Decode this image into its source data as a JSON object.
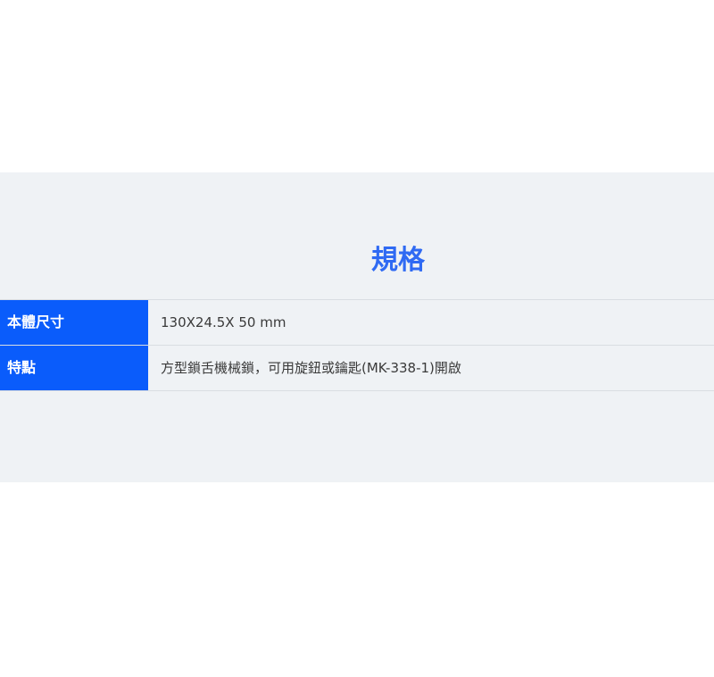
{
  "spec": {
    "title": "規格",
    "rows": [
      {
        "label": "本體尺寸",
        "value": "130X24.5X 50 mm"
      },
      {
        "label": "特點",
        "value": "方型鎖舌機械鎖，可用旋鈕或鑰匙(MK-338-1)開啟"
      }
    ]
  },
  "colors": {
    "section_background": "#eff2f5",
    "title": "#2f6af3",
    "label_background": "#0a5cfb"
  }
}
